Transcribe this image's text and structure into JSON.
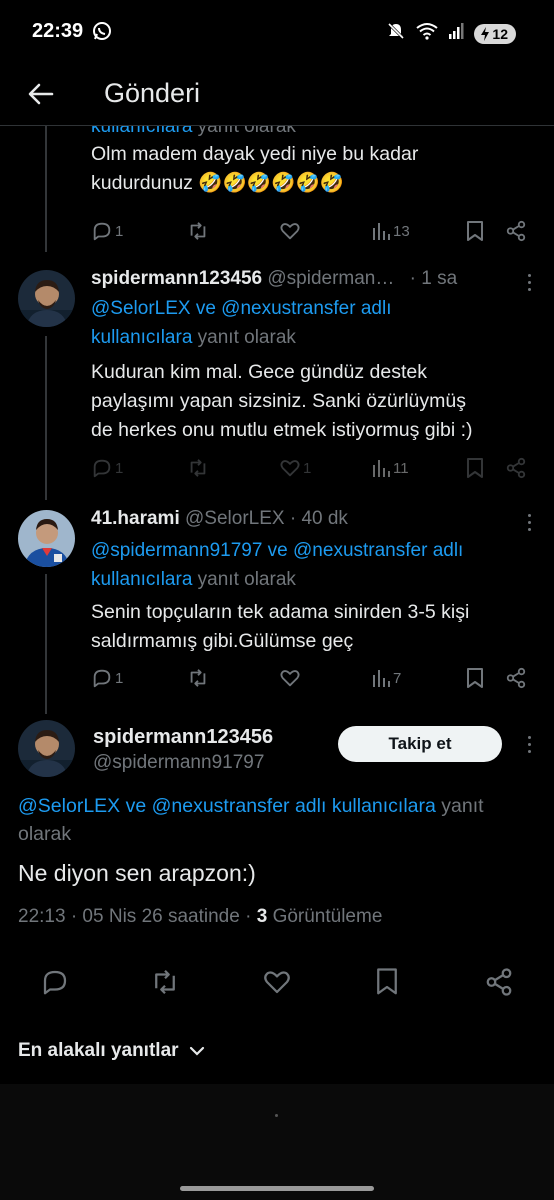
{
  "status_bar": {
    "time": "22:39",
    "battery": "12"
  },
  "header": {
    "title": "Gönderi"
  },
  "tweets": [
    {
      "reply_to_tail": "kullanıcılara yanıt olarak",
      "text_lines": [
        "Olm madem dayak yedi niye bu kadar",
        "kudurdunuz 🤣🤣🤣🤣🤣🤣"
      ],
      "replies": "1",
      "likes": "",
      "views": "13"
    },
    {
      "name": "spidermann123456",
      "handle": "@spiderman…",
      "time": "· 1 sa",
      "reply_mentions": "@SelorLEX ve @nexustransfer adlı",
      "reply_mentions2": "kullanıcılara",
      "reply_suffix": "yanıt olarak",
      "text_lines": [
        "Kuduran kim mal. Gece gündüz destek",
        "paylaşımı yapan sizsiniz. Sanki özürlüymüş",
        "de herkes onu mutlu etmek istiyormuş gibi :)"
      ],
      "replies": "1",
      "likes": "1",
      "views": "11"
    },
    {
      "name": "41.harami",
      "handle": "@SelorLEX · 40 dk",
      "reply_mentions": "@spidermann91797 ve @nexustransfer adlı",
      "reply_mentions2": "kullanıcılara",
      "reply_suffix": "yanıt olarak",
      "text_lines": [
        "Senin topçuların tek adama sinirden 3-5 kişi",
        "saldırmamış gibi.Gülümse geç"
      ],
      "replies": "1",
      "likes": "",
      "views": "7"
    }
  ],
  "main_tweet": {
    "name": "spidermann123456",
    "handle": "@spidermann91797",
    "follow_label": "Takip et",
    "reply_mentions": "@SelorLEX ve @nexustransfer adlı kullanıcılara",
    "reply_suffix": "yanıt",
    "reply_suffix2": "olarak",
    "text": "Ne diyon sen arapzon:)",
    "meta_time": "22:13 · 05 Nis 26 saatinde ·",
    "meta_views": "3",
    "meta_views_label": "Görüntüleme"
  },
  "sort": {
    "label": "En alakalı yanıtlar"
  },
  "colors": {
    "accent": "#1d9bf0",
    "background": "#000000",
    "muted": "#71767b"
  }
}
